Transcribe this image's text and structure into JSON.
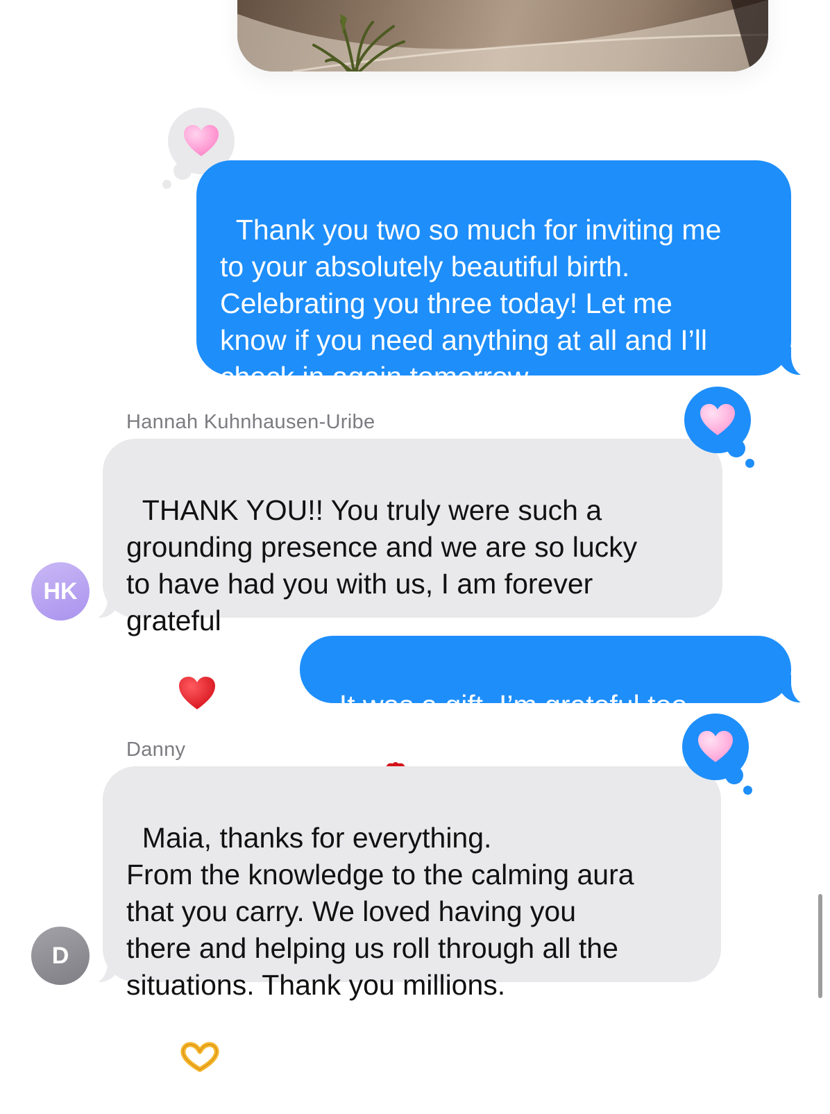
{
  "conversation": {
    "photo_attachment": {
      "icon": "photo-image"
    },
    "messages": [
      {
        "direction": "sent",
        "text": "Thank you two so much for inviting me\nto your absolutely beautiful birth.\nCelebrating you three today! Let me\nknow if you need anything at all and I’ll\ncheck in again tomorrow.",
        "tapback": "pink-heart-icon"
      },
      {
        "direction": "received",
        "sender": "Hannah Kuhnhausen-Uribe",
        "avatar_initials": "HK",
        "text": "THANK YOU!! You truly were such a\ngrounding presence and we are so lucky\nto have had you with us, I am forever\ngrateful",
        "emoji": "red-heart-icon",
        "tapback": "pink-heart-icon"
      },
      {
        "direction": "sent",
        "text": "It was a gift, I’m grateful too",
        "emoji": "rose-icon"
      },
      {
        "direction": "received",
        "sender": "Danny",
        "avatar_initials": "D",
        "text": "Maia, thanks for everything.\nFrom the knowledge to the calming aura\nthat you carry. We loved having you\nthere and helping us roll through all the\nsituations. Thank you millions.",
        "emoji": "heart-hands-icon",
        "tapback": "pink-heart-icon"
      }
    ]
  },
  "colors": {
    "sent_bubble": "#1e8efa",
    "received_bubble": "#e9e9eb",
    "avatar_hk": "#b9a5f2",
    "avatar_d": "#8e8e93",
    "pink_heart": "#ff8fcf",
    "red_heart": "#e0121b"
  }
}
